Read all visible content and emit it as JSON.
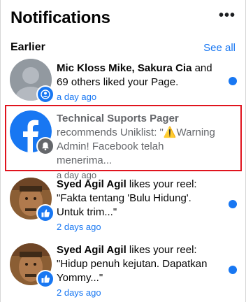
{
  "header": {
    "title": "Notifications",
    "more_label": "•••"
  },
  "section": {
    "title": "Earlier",
    "see_all": "See all"
  },
  "notifications": [
    {
      "actors": "Mic Kloss Mike, Sakura Cia",
      "message": " and 69 others liked your Page.",
      "time": "a day ago",
      "badge_icon": "person-icon",
      "unread": true
    },
    {
      "actors": "Technical Suports Pager",
      "message": " recommends Uniklist: \"⚠️Warning Admin! Facebook telah menerima...",
      "time": "a day ago",
      "badge_icon": "bell-icon",
      "unread": false
    },
    {
      "actors": "Syed Agil Agil",
      "message": " likes your reel: \"Fakta tentang 'Bulu Hidung'. Untuk trim...\"",
      "time": "2 days ago",
      "badge_icon": "like-icon",
      "unread": true
    },
    {
      "actors": "Syed Agil Agil",
      "message": " likes your reel: \"Hidup penuh kejutan. Dapatkan Yommy...\"",
      "time": "2 days ago",
      "badge_icon": "like-icon",
      "unread": true
    }
  ],
  "colors": {
    "accent": "#1877f2",
    "highlight_border": "#e0141e",
    "unread_dot": "#1877f2"
  }
}
